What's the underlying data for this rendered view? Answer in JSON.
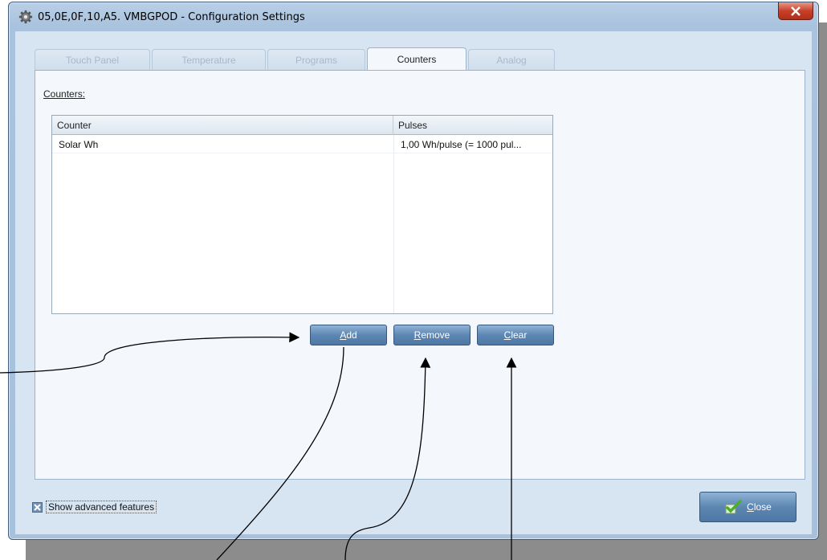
{
  "window": {
    "title": "05,0E,0F,10,A5. VMBGPOD - Configuration Settings",
    "icon": "gear-icon"
  },
  "tabs": [
    {
      "label": "Touch Panel",
      "active": false
    },
    {
      "label": "Temperature",
      "active": false
    },
    {
      "label": "Programs",
      "active": false
    },
    {
      "label": "Counters",
      "active": true
    },
    {
      "label": "Analog",
      "active": false
    }
  ],
  "counters": {
    "section_label": "Counters:",
    "columns": [
      "Counter",
      "Pulses"
    ],
    "rows": [
      {
        "counter": "Solar Wh",
        "pulses": "1,00 Wh/pulse (= 1000 pul..."
      }
    ]
  },
  "buttons": {
    "add_prefix": "",
    "add_mnemonic": "A",
    "add_rest": "dd",
    "remove_mnemonic": "R",
    "remove_rest": "emove",
    "clear_mnemonic": "C",
    "clear_rest": "lear"
  },
  "footer": {
    "advanced_label": "Show advanced features",
    "advanced_checked": true,
    "close_mnemonic": "C",
    "close_rest": "lose"
  },
  "colors": {
    "button_blue": "#5d86b2",
    "title_close_red": "#c7402a",
    "panel_bg": "#f4f8fc"
  }
}
